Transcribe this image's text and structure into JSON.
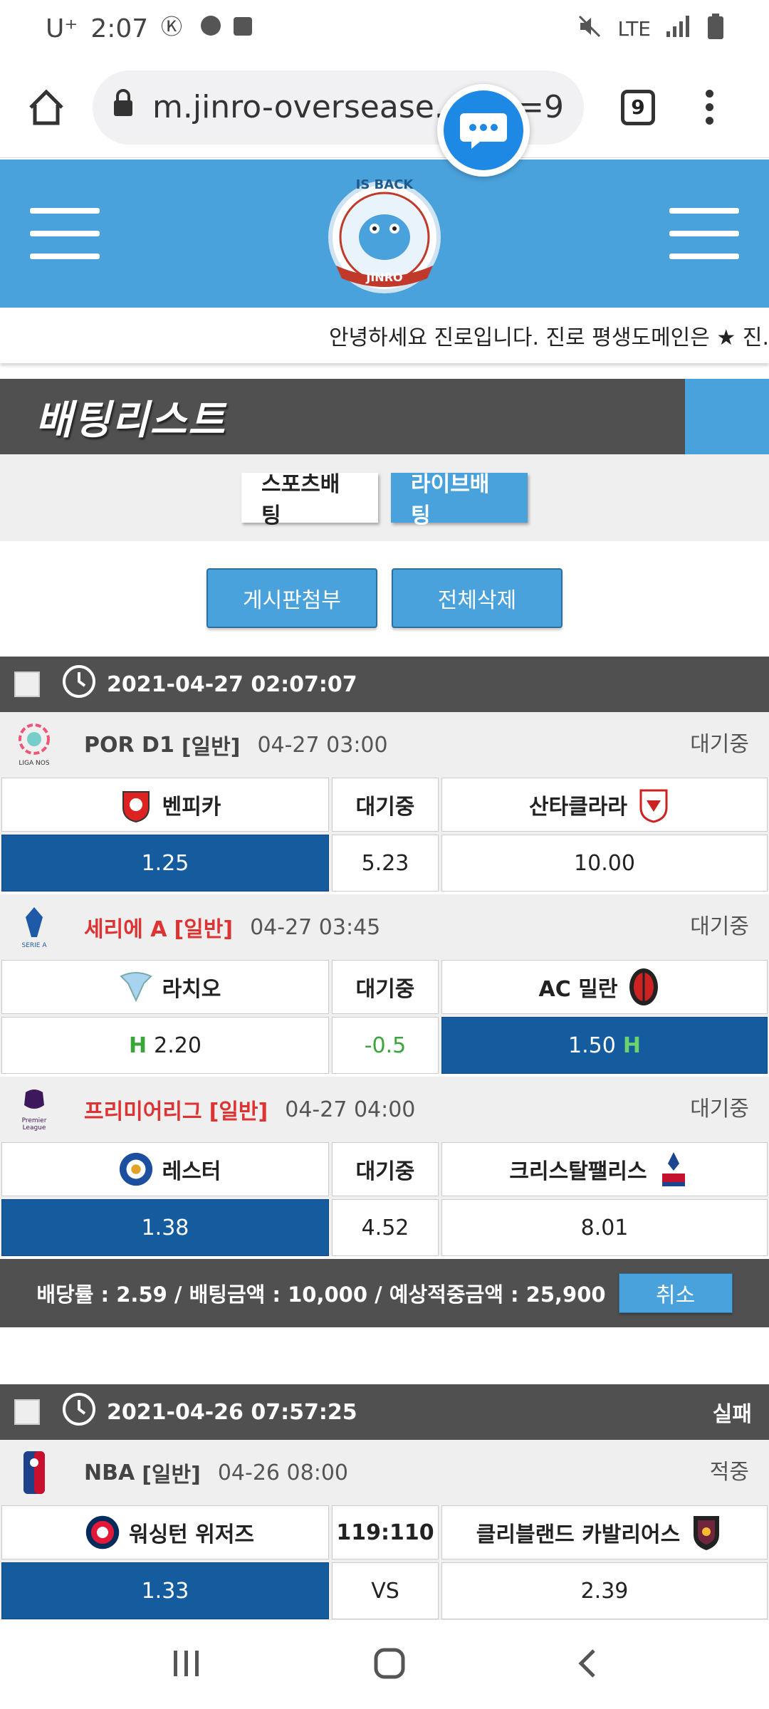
{
  "status_bar": {
    "carrier": "U⁺",
    "time": "2:07",
    "network": "LTE"
  },
  "browser": {
    "url": "m.jinro-oversease.c",
    "url_tail": "m=9",
    "tab_count": "9"
  },
  "ticker_text": "안녕하세요 진로입니다. 진로 평생도메인은 ★ 진.",
  "page_title": "배팅리스트",
  "tabs": {
    "sports": "스포츠배팅",
    "live": "라이브배팅"
  },
  "actions": {
    "attach": "게시판첨부",
    "delete_all": "전체삭제"
  },
  "slips": [
    {
      "datetime": "2021-04-27 02:07:07",
      "status": "",
      "games": [
        {
          "league": "POR D1",
          "type": "[일반]",
          "time": "04-27 03:00",
          "status": "대기중",
          "red": false,
          "home": "벤피카",
          "mid": "대기중",
          "away": "산타클라라",
          "odds": {
            "home": "1.25",
            "mid": "5.23",
            "away": "10.00"
          },
          "selected": "home"
        },
        {
          "league": "세리에 A",
          "type": "[일반]",
          "time": "04-27 03:45",
          "status": "대기중",
          "red": true,
          "home": "라치오",
          "mid": "대기중",
          "away": "AC 밀란",
          "odds": {
            "home": "2.20",
            "mid": "-0.5",
            "away": "1.50"
          },
          "selected": "away",
          "handicap_mark": "H"
        },
        {
          "league": "프리미어리그",
          "type": "[일반]",
          "time": "04-27 04:00",
          "status": "대기중",
          "red": true,
          "home": "레스터",
          "mid": "대기중",
          "away": "크리스탈팰리스",
          "odds": {
            "home": "1.38",
            "mid": "4.52",
            "away": "8.01"
          },
          "selected": "home"
        }
      ],
      "summary": {
        "text": "배당률 : 2.59 / 배팅금액 : 10,000 / 예상적중금액 : 25,900",
        "cancel": "취소"
      }
    },
    {
      "datetime": "2021-04-26 07:57:25",
      "status": "실패",
      "games": [
        {
          "league": "NBA",
          "type": "[일반]",
          "time": "04-26 08:00",
          "status": "적중",
          "red": false,
          "home": "워싱턴 위저즈",
          "mid": "119:110",
          "away": "클리블랜드 카발리어스",
          "odds": {
            "home": "1.33",
            "mid": "VS",
            "away": "2.39"
          },
          "selected": "home"
        }
      ]
    }
  ],
  "colors": {
    "accent": "#4aa2dc",
    "selected": "#145c9e",
    "dark": "#505050",
    "red": "#dd3333"
  }
}
